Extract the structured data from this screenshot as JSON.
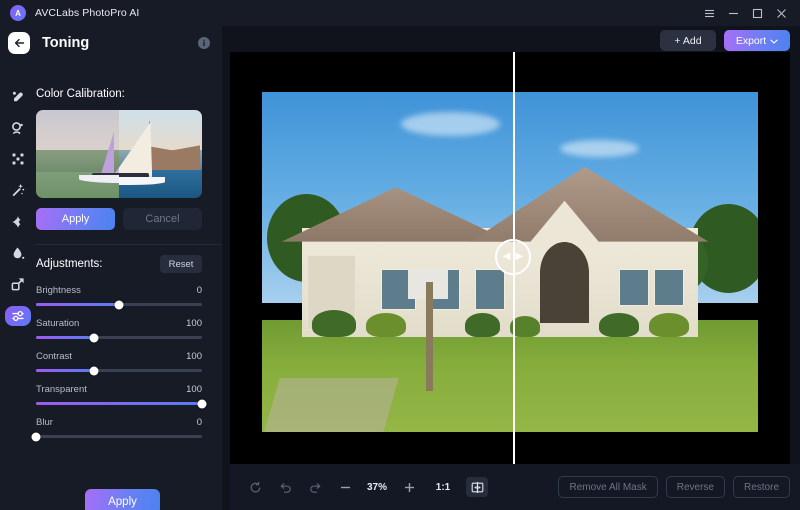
{
  "window": {
    "app_title": "AVCLabs PhotoPro AI",
    "logo_text": "A",
    "controls": [
      {
        "name": "menu-icon",
        "glyph": "menu"
      },
      {
        "name": "minimize-icon",
        "glyph": "minimize"
      },
      {
        "name": "maximize-icon",
        "glyph": "maximize"
      },
      {
        "name": "close-icon",
        "glyph": "close"
      }
    ]
  },
  "panel": {
    "title": "Toning",
    "back_label": "",
    "info_label": "i",
    "color_calibration_label": "Color Calibration:",
    "apply_label": "Apply",
    "cancel_label": "Cancel",
    "adjustments_label": "Adjustments:",
    "reset_label": "Reset",
    "apply_main_label": "Apply"
  },
  "tool_rail": [
    {
      "name": "retouch-icon",
      "active": false
    },
    {
      "name": "portrait-icon",
      "active": false
    },
    {
      "name": "denoise-icon",
      "active": false
    },
    {
      "name": "magic-wand-icon",
      "active": false
    },
    {
      "name": "enhance-icon",
      "active": false
    },
    {
      "name": "color-drop-icon",
      "active": false
    },
    {
      "name": "upscale-icon",
      "active": false
    },
    {
      "name": "toning-sliders-icon",
      "active": true
    }
  ],
  "sliders": [
    {
      "label": "Brightness",
      "value": "0",
      "percent": 50
    },
    {
      "label": "Saturation",
      "value": "100",
      "percent": 35
    },
    {
      "label": "Contrast",
      "value": "100",
      "percent": 35
    },
    {
      "label": "Transparent",
      "value": "100",
      "percent": 100
    },
    {
      "label": "Blur",
      "value": "0",
      "percent": 0
    }
  ],
  "top_actions": {
    "add_label": "+ Add",
    "export_label": "Export",
    "export_caret": "⌄"
  },
  "bottom_bar": {
    "refresh_icon": "refresh-icon",
    "undo_icon": "undo-icon",
    "redo_icon": "redo-icon",
    "zoom_out_label": "−",
    "zoom_value": "37%",
    "zoom_in_label": "+",
    "fit_label": "1:1",
    "compare_icon": "split-compare-icon",
    "remove_all_mask_label": "Remove All Mask",
    "reverse_label": "Reverse",
    "restore_label": "Restore"
  },
  "canvas": {
    "split_handle_left_arrow": "◀",
    "split_handle_right_arrow": "▶"
  },
  "colors": {
    "accent_start": "#a86ef7",
    "accent_end": "#4b82f0",
    "sidebar_bg": "#171b26",
    "canvas_bg": "#000000",
    "bottom_bg": "#141824"
  }
}
